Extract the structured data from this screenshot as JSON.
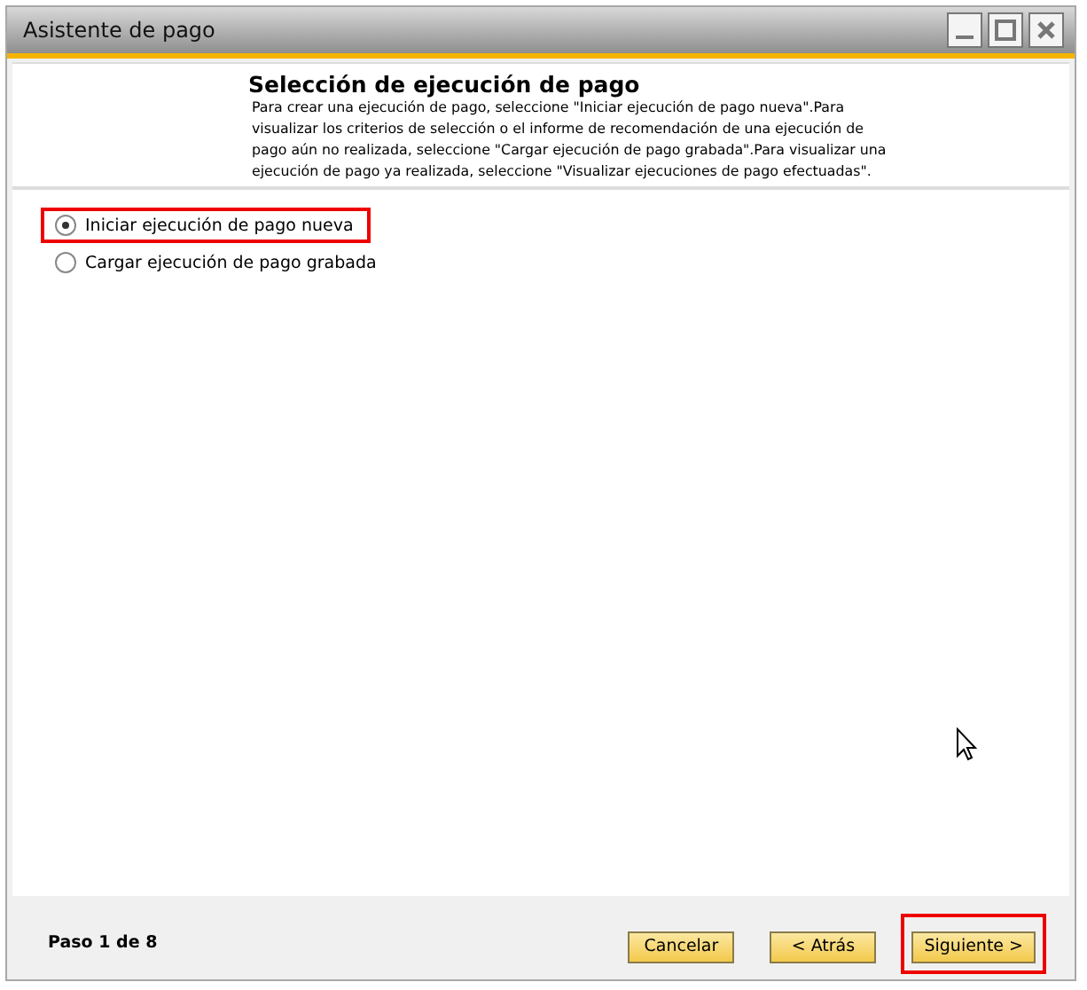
{
  "window": {
    "title": "Asistente de pago",
    "controls": [
      {
        "kind": "minimize"
      },
      {
        "kind": "maximize"
      },
      {
        "kind": "close"
      }
    ]
  },
  "header": {
    "title": "Selección de ejecución de pago",
    "description": "Para crear una ejecución de pago, seleccione \"Iniciar ejecución de pago nueva\".Para visualizar los criterios de selección o el informe de recomendación de una ejecución de pago aún no realizada, seleccione \"Cargar ejecución de pago grabada\".Para visualizar una ejecución de pago ya realizada, seleccione \"Visualizar ejecuciones de pago efectuadas\"."
  },
  "options": [
    {
      "label": "Iniciar ejecución de pago nueva",
      "selected": true,
      "highlighted": true
    },
    {
      "label": "Cargar ejecución de pago grabada",
      "selected": false,
      "highlighted": false
    }
  ],
  "footer": {
    "step": "Paso 1 de 8",
    "buttons": [
      {
        "label": "Cancelar",
        "highlighted": false
      },
      {
        "label": "< Atrás",
        "highlighted": false
      },
      {
        "label": "Siguiente >",
        "highlighted": true
      }
    ]
  }
}
